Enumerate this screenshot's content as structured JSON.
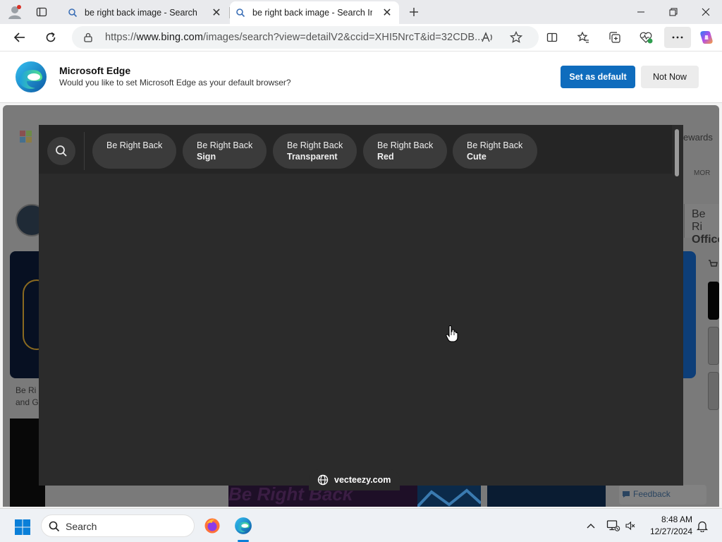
{
  "browser": {
    "tabs": [
      {
        "title": "be right back image - Search",
        "active": false
      },
      {
        "title": "be right back image - Search Images",
        "active": true
      }
    ],
    "address": {
      "scheme": "https://",
      "host": "www.bing.com",
      "path": "/images/search?view=detailV2&ccid=XHI5NrcT&id=32CDB..."
    }
  },
  "infobar": {
    "title": "Microsoft Edge",
    "message": "Would you like to set Microsoft Edge as your default browser?",
    "primary_button": "Set as default",
    "secondary_button": "Not Now"
  },
  "background_page": {
    "rewards_label": "ewards",
    "more_label": "MOR",
    "right_card_line1": "Be Ri",
    "right_card_line2": "Office",
    "left_caption_line1": "Be Ri",
    "left_caption_line2": "and G",
    "feedback_label": "Feedback",
    "image_text": "Be Right Back"
  },
  "viewer": {
    "related_searches": [
      {
        "line1": "Be Right Back",
        "line2": ""
      },
      {
        "line1": "Be Right Back",
        "line2": "Sign"
      },
      {
        "line1": "Be Right Back",
        "line2": "Transparent"
      },
      {
        "line1": "Be Right Back",
        "line2": "Red"
      },
      {
        "line1": "Be Right Back",
        "line2": "Cute"
      }
    ],
    "source_domain": "vecteezy.com"
  },
  "taskbar": {
    "search_placeholder": "Search",
    "time": "8:48 AM",
    "date": "12/27/2024"
  },
  "colors": {
    "accent_blue": "#0f6cbd",
    "viewer_bg": "#2b2b2b",
    "chip_bg": "#3b3b3b"
  }
}
